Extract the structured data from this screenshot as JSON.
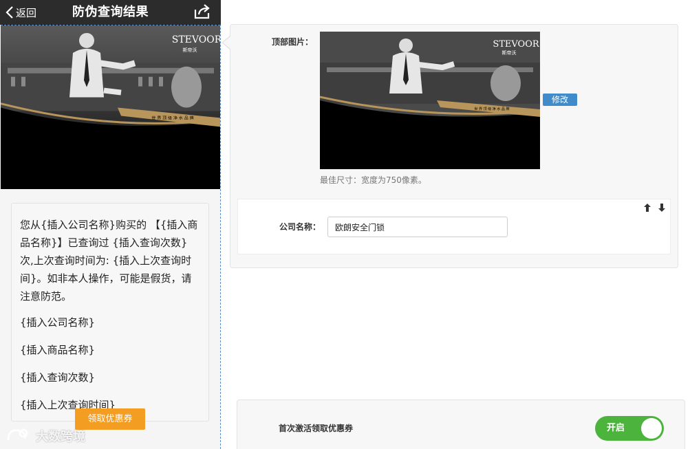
{
  "phone": {
    "topbar": {
      "back_label": "返回",
      "title": "防伪查询结果"
    },
    "banner": {
      "brand_name": "STEVOOR",
      "brand_cn": "斯帝沃",
      "slogan": "世 界 顶 级 净 水 品 牌"
    },
    "info": {
      "message": "您从{插入公司名称}购买的 【{插入商品名称}】已查询过 {插入查询次数}次,上次查询时间为: {插入上次查询时间}。如非本人操作，可能是假货，请注意防范。",
      "placeholders": [
        "{插入公司名称}",
        "{插入商品名称}",
        "{插入查询次数}",
        "{插入上次查询时间}"
      ]
    },
    "coupon_button": "领取优惠券",
    "watermark": "大数跨境"
  },
  "settings": {
    "top_image_label": "顶部图片：",
    "edit_button": "修改",
    "size_hint": "最佳尺寸：宽度为750像素。",
    "company_label": "公司名称：",
    "company_value": "欧朗安全门锁",
    "coupon_setting_label": "首次激活领取优惠券",
    "toggle_label": "开启",
    "toggle_on": true
  },
  "colors": {
    "topbar_bg": "#2c2c2c",
    "coupon_orange": "#f39d23",
    "edit_blue": "#428bca",
    "toggle_green": "#4cb33d",
    "banner_gold": "#b8955a"
  }
}
